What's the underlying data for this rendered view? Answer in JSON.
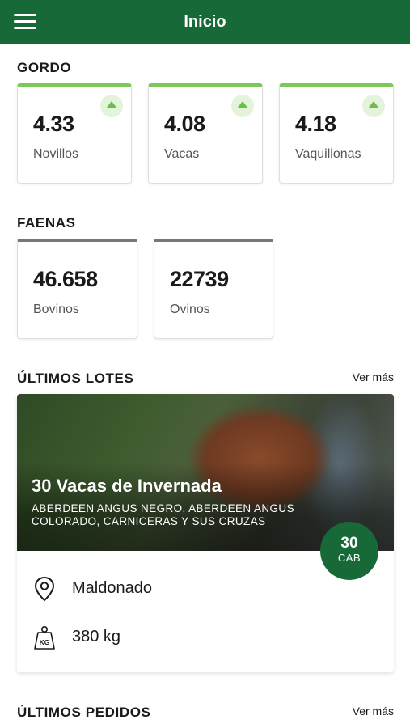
{
  "header": {
    "title": "Inicio",
    "menu_icon": "hamburger-menu-icon",
    "bg_color": "#176a38"
  },
  "gordo": {
    "title": "GORDO",
    "items": [
      {
        "value": "4.33",
        "label": "Novillos",
        "trend": "up"
      },
      {
        "value": "4.08",
        "label": "Vacas",
        "trend": "up"
      },
      {
        "value": "4.18",
        "label": "Vaquillonas",
        "trend": "up"
      }
    ]
  },
  "faenas": {
    "title": "FAENAS",
    "items": [
      {
        "value": "46.658",
        "label": "Bovinos"
      },
      {
        "value": "22739",
        "label": "Ovinos"
      }
    ]
  },
  "lotes": {
    "title": "ÚLTIMOS LOTES",
    "see_more": "Ver más",
    "lot": {
      "title": "30 Vacas de Invernada",
      "breed": "ABERDEEN ANGUS NEGRO, ABERDEEN ANGUS COLORADO, CARNICERAS Y SUS CRUZAS",
      "count": "30",
      "count_unit": "CAB",
      "location": "Maldonado",
      "weight": "380 kg",
      "location_icon": "map-pin-icon",
      "weight_icon": "kg-weight-icon"
    }
  },
  "pedidos": {
    "title": "ÚLTIMOS PEDIDOS",
    "see_more": "Ver más"
  },
  "colors": {
    "accent": "#176a38",
    "trend_up": "#6cc04a",
    "card_gray": "#777777"
  }
}
